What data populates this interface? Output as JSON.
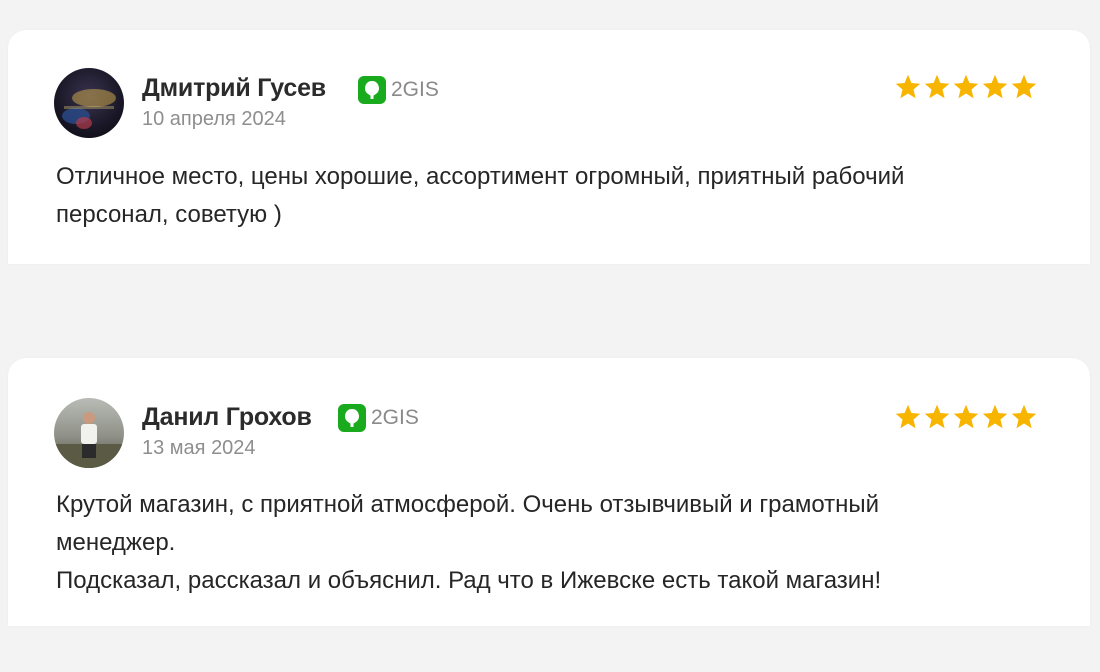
{
  "reviews": [
    {
      "author": "Дмитрий Гусев",
      "source": "2GIS",
      "date": "10 апреля 2024",
      "rating": 5,
      "text": "Отличное место, цены хорошие, ассортимент огромный, приятный рабочий\nперсонал, советую )"
    },
    {
      "author": "Данил Грохов",
      "source": "2GIS",
      "date": "13 мая 2024",
      "rating": 5,
      "text": "Крутой магазин, с приятной атмосферой. Очень отзывчивый и грамотный\nменеджер.\nПодсказал, рассказал и объяснил. Рад что в Ижевске есть такой магазин!"
    }
  ],
  "colors": {
    "star": "#f7b500",
    "source_logo": "#19aa1e",
    "page_background": "#f3f3f3",
    "card_background": "#ffffff"
  },
  "icons": {
    "source_logo": "2gis-logo-icon",
    "rating": "star-icon"
  }
}
